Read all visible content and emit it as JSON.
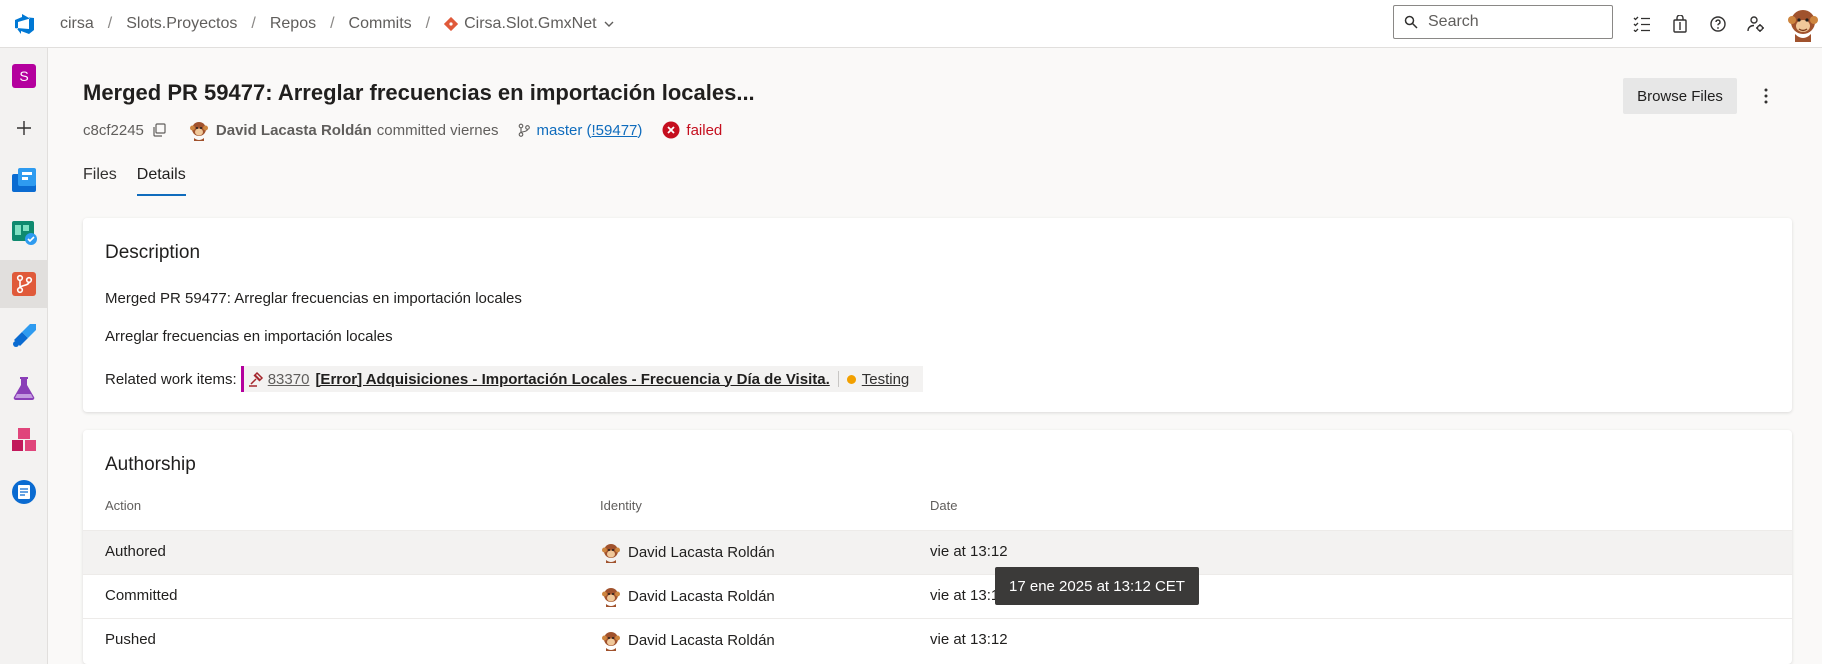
{
  "breadcrumb": {
    "org": "cirsa",
    "project": "Slots.Proyectos",
    "section": "Repos",
    "page": "Commits",
    "repo": "Cirsa.Slot.GmxNet"
  },
  "search": {
    "placeholder": "Search"
  },
  "header": {
    "title": "Merged PR 59477: Arreglar frecuencias en importación locales...",
    "hash": "c8cf2245",
    "author": "David Lacasta Roldán",
    "committed_text": "committed viernes",
    "branch": "master",
    "pr_open": " (",
    "pr_link": "!59477",
    "pr_close": ")",
    "status": "failed",
    "browse_label": "Browse Files"
  },
  "tabs": [
    "Files",
    "Details"
  ],
  "description": {
    "heading": "Description",
    "line1": "Merged PR 59477: Arreglar frecuencias en importación locales",
    "line2": "Arreglar frecuencias en importación locales",
    "related_label": "Related work items:",
    "work_item": {
      "id": "83370",
      "title": "[Error] Adquisiciones - Importación Locales - Frecuencia y Día de Visita.",
      "state": "Testing"
    }
  },
  "authorship": {
    "heading": "Authorship",
    "columns": [
      "Action",
      "Identity",
      "Date"
    ],
    "rows": [
      {
        "action": "Authored",
        "identity": "David Lacasta Roldán",
        "date": "vie at 13:12"
      },
      {
        "action": "Committed",
        "identity": "David Lacasta Roldán",
        "date": "vie at 13:1"
      },
      {
        "action": "Pushed",
        "identity": "David Lacasta Roldán",
        "date": "vie at 13:12"
      }
    ]
  },
  "tooltip": "17 ene 2025 at 13:12 CET",
  "left_nav": {
    "project_initial": "S",
    "icons": [
      "add-icon",
      "boards-icon",
      "test-plans-check-icon",
      "repos-icon",
      "pipelines-icon",
      "test-plans-icon",
      "artifacts-icon",
      "wiki-icon"
    ]
  },
  "colors": {
    "accent": "#0f6cbd",
    "failed": "#c50f1f",
    "project_tile": "#b4009e",
    "state_dot": "#f2a000"
  }
}
